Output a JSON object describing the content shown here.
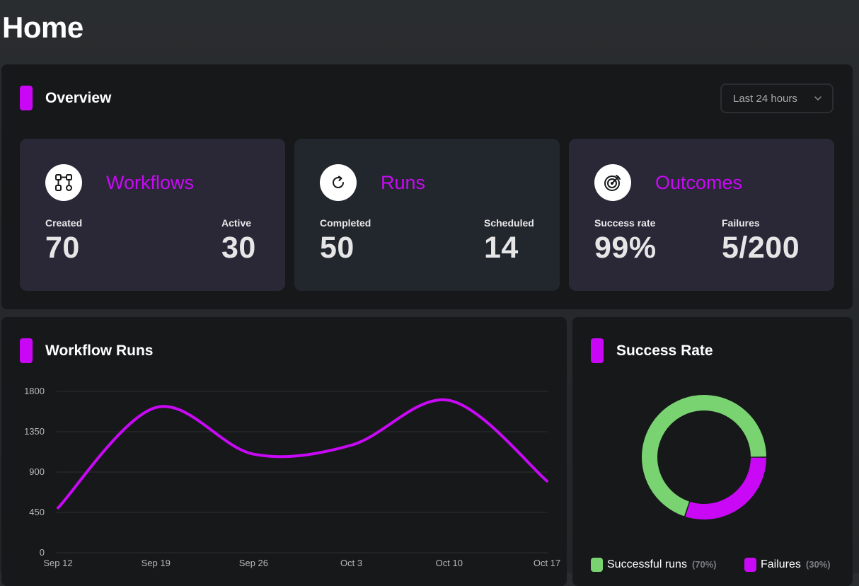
{
  "page": {
    "title": "Home"
  },
  "overview": {
    "title": "Overview",
    "range_selector": {
      "value": "Last 24 hours"
    },
    "cards": [
      {
        "title": "Workflows",
        "icon": "workflow-icon",
        "stats": [
          {
            "label": "Created",
            "value": "70"
          },
          {
            "label": "Active",
            "value": "30"
          }
        ]
      },
      {
        "title": "Runs",
        "icon": "refresh-icon",
        "stats": [
          {
            "label": "Completed",
            "value": "50"
          },
          {
            "label": "Scheduled",
            "value": "14"
          }
        ]
      },
      {
        "title": "Outcomes",
        "icon": "target-icon",
        "stats": [
          {
            "label": "Success rate",
            "value": "99%"
          },
          {
            "label": "Failures",
            "value": "5/200"
          }
        ]
      }
    ]
  },
  "workflow_runs": {
    "title": "Workflow Runs"
  },
  "success_rate": {
    "title": "Success Rate",
    "legend": [
      {
        "name": "Successful runs",
        "pct": "(70%)",
        "color": "#79d370"
      },
      {
        "name": "Failures",
        "pct": "(30%)",
        "color": "#c909f6"
      }
    ]
  },
  "colors": {
    "accent": "#c909f6",
    "success": "#79d370",
    "panel_bg": "#161819",
    "grid": "#2c2f31"
  },
  "chart_data": [
    {
      "type": "line",
      "title": "Workflow Runs",
      "x": [
        "Sep 12",
        "Sep 19",
        "Sep 26",
        "Oct 3",
        "Oct 10",
        "Oct 17"
      ],
      "series": [
        {
          "values": [
            500,
            1620,
            1100,
            1200,
            1700,
            800
          ]
        }
      ],
      "yticks": [
        0,
        450,
        900,
        1350,
        1800
      ],
      "ylim": [
        0,
        1800
      ],
      "grid": true
    },
    {
      "type": "pie",
      "title": "Success Rate",
      "labels": [
        "Successful runs",
        "Failures"
      ],
      "values": [
        70,
        30
      ]
    }
  ]
}
